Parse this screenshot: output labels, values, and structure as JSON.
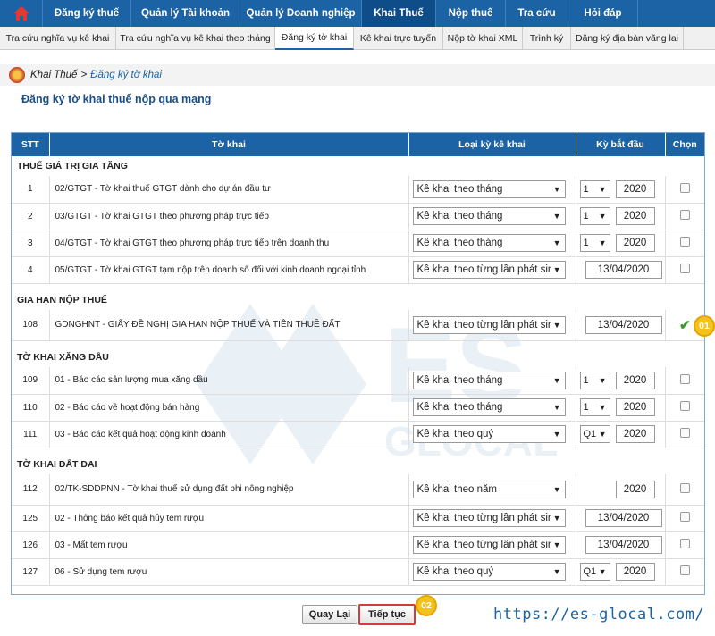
{
  "topnav": {
    "items": [
      {
        "label": "Đăng ký thuế"
      },
      {
        "label": "Quản lý Tài khoản"
      },
      {
        "label": "Quản lý Doanh nghiệp"
      },
      {
        "label": "Khai Thuế",
        "active": true
      },
      {
        "label": "Nộp thuế"
      },
      {
        "label": "Tra cứu"
      },
      {
        "label": "Hỏi đáp"
      }
    ]
  },
  "subnav": {
    "items": [
      {
        "label": "Tra cứu nghĩa vụ kê khai"
      },
      {
        "label": "Tra cứu nghĩa vụ kê khai theo tháng"
      },
      {
        "label": "Đăng ký tờ khai",
        "active": true
      },
      {
        "label": "Kê khai trực tuyến"
      },
      {
        "label": "Nộp tờ khai XML"
      },
      {
        "label": "Trình ký"
      },
      {
        "label": "Đăng ký địa bàn vãng lai"
      }
    ]
  },
  "breadcrumb": {
    "parent": "Khai Thuế",
    "separator": ">",
    "current": "Đăng ký tờ khai"
  },
  "page_title": "Đăng ký tờ khai thuế nộp qua mạng",
  "table": {
    "headers": {
      "stt": "STT",
      "form": "Tờ khai",
      "type": "Loại kỳ kê khai",
      "start": "Kỳ bắt đầu",
      "choose": "Chọn"
    },
    "groups": [
      {
        "title": "THUẾ GIÁ TRỊ GIA TĂNG",
        "rows": [
          {
            "stt": "1",
            "name": "02/GTGT - Tờ khai thuế GTGT dành cho dự án đầu tư",
            "type": "Kê khai theo tháng",
            "period": "1",
            "year": "2020",
            "date": "",
            "checked": false
          },
          {
            "stt": "2",
            "name": "03/GTGT - Tờ khai GTGT theo phương pháp trực tiếp",
            "type": "Kê khai theo tháng",
            "period": "1",
            "year": "2020",
            "date": "",
            "checked": false
          },
          {
            "stt": "3",
            "name": "04/GTGT - Tờ khai GTGT theo phương pháp trực tiếp trên doanh thu",
            "type": "Kê khai theo tháng",
            "period": "1",
            "year": "2020",
            "date": "",
            "checked": false
          },
          {
            "stt": "4",
            "name": "05/GTGT - Tờ khai GTGT tạm nộp trên doanh số đối với kinh doanh ngoại tỉnh",
            "type": "Kê khai theo từng lần phát sinh",
            "period": "",
            "year": "",
            "date": "13/04/2020",
            "checked": false
          }
        ]
      },
      {
        "title": "GIA HẠN NỘP THUẾ",
        "rows": [
          {
            "stt": "108",
            "name": "GDNGHNT - GIẤY ĐỀ NGHỊ GIA HẠN NỘP THUẾ VÀ TIỀN THUÊ ĐẤT",
            "type": "Kê khai theo từng lần phát sinh",
            "period": "",
            "year": "",
            "date": "13/04/2020",
            "checked": true
          }
        ]
      },
      {
        "title": "TỜ KHAI XĂNG DẦU",
        "rows": [
          {
            "stt": "109",
            "name": "01 - Báo cáo sản lượng mua xăng dầu",
            "type": "Kê khai theo tháng",
            "period": "1",
            "year": "2020",
            "date": "",
            "checked": false
          },
          {
            "stt": "110",
            "name": "02 - Báo cáo về hoạt động bán hàng",
            "type": "Kê khai theo tháng",
            "period": "1",
            "year": "2020",
            "date": "",
            "checked": false
          },
          {
            "stt": "111",
            "name": "03 - Báo cáo kết quả hoạt động kinh doanh",
            "type": "Kê khai theo quý",
            "period": "Q1",
            "year": "2020",
            "date": "",
            "checked": false
          }
        ]
      },
      {
        "title": "TỜ KHAI ĐẤT ĐAI",
        "rows": [
          {
            "stt": "112",
            "name": "02/TK-SDDPNN - Tờ khai thuế sử dụng đất phi nông nghiệp",
            "type": "Kê khai theo năm",
            "period": "",
            "year": "2020",
            "date": "",
            "checked": false
          },
          {
            "stt": "125",
            "name": "02 - Thông báo kết quả hủy tem rượu",
            "type": "Kê khai theo từng lần phát sinh",
            "period": "",
            "year": "",
            "date": "13/04/2020",
            "checked": false
          },
          {
            "stt": "126",
            "name": "03 - Mất tem rượu",
            "type": "Kê khai theo từng lần phát sinh",
            "period": "",
            "year": "",
            "date": "13/04/2020",
            "checked": false
          },
          {
            "stt": "127",
            "name": "06 - Sử dụng tem rượu",
            "type": "Kê khai theo quý",
            "period": "Q1",
            "year": "2020",
            "date": "",
            "checked": false
          }
        ]
      }
    ]
  },
  "buttons": {
    "back": "Quay Lại",
    "next": "Tiếp tục"
  },
  "badges": {
    "step1": "01",
    "step2": "02"
  },
  "watermark_url": "https://es-glocal.com/",
  "colors": {
    "nav_bg": "#1b63a4",
    "header_bg": "#1b63a4",
    "badge": "#f4c21c",
    "highlight": "#d23c3c",
    "check": "#3a9a2a"
  }
}
